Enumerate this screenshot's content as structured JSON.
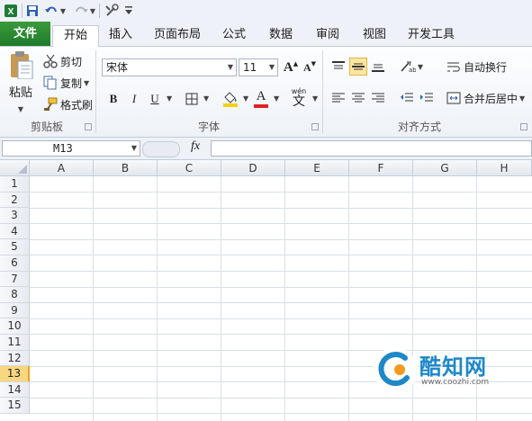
{
  "quick_access": {
    "app_icon": "excel-icon",
    "save_icon": "save-icon",
    "undo_icon": "undo-icon",
    "redo_icon": "redo-icon",
    "custom_icon": "tools-icon"
  },
  "tabs": {
    "file": "文件",
    "home": "开始",
    "insert": "插入",
    "page_layout": "页面布局",
    "formulas": "公式",
    "data": "数据",
    "review": "审阅",
    "view": "视图",
    "developer": "开发工具"
  },
  "clipboard": {
    "paste": "粘贴",
    "cut": "剪切",
    "copy": "复制",
    "format_painter": "格式刷",
    "title": "剪贴板"
  },
  "font": {
    "name": "宋体",
    "size": "11",
    "bold": "B",
    "italic": "I",
    "underline": "U",
    "increase": "A",
    "decrease": "A",
    "font_color_glyph": "A",
    "phonetic_glyph": "文",
    "phonetic_top": "wén",
    "title": "字体",
    "colors": {
      "fill": "#f5d10f",
      "font": "#e02020"
    }
  },
  "alignment": {
    "wrap_text": "自动换行",
    "merge_center": "合并后居中",
    "title": "对齐方式"
  },
  "formula_bar": {
    "name_box": "M13",
    "fx": "fx",
    "value": ""
  },
  "grid": {
    "columns": [
      "A",
      "B",
      "C",
      "D",
      "E",
      "F",
      "G",
      "H"
    ],
    "rows": [
      "1",
      "2",
      "3",
      "4",
      "5",
      "6",
      "7",
      "8",
      "9",
      "10",
      "11",
      "12",
      "13",
      "14",
      "15"
    ],
    "selected_row": "13"
  },
  "watermark": {
    "name": "酷知网",
    "url": "www.coozhi.com"
  },
  "colors": {
    "file_tab": "#1e7b2a",
    "selected_row_header": "#f7d780",
    "watermark_blue": "#1e88c8",
    "watermark_orange": "#f39a1e"
  }
}
